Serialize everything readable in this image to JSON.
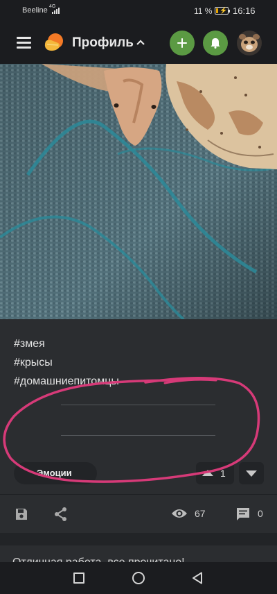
{
  "status_bar": {
    "carrier": "Beeline",
    "network": "4G",
    "battery_percent": "11 %",
    "time": "16:16"
  },
  "top_bar": {
    "title": "Профиль",
    "icons": [
      "menu-icon",
      "logo-icon",
      "chevron-up-icon",
      "plus-icon",
      "bell-icon",
      "avatar"
    ],
    "accent_color": "#5b9a43"
  },
  "post": {
    "tags": [
      "#змея",
      "#крысы",
      "#домашниепитомцы"
    ],
    "emotions_label": "Эмоции",
    "votes": "1"
  },
  "actions": {
    "views": "67",
    "comments": "0",
    "icons": [
      "save-icon",
      "share-icon",
      "eye-icon",
      "comment-icon"
    ]
  },
  "comment_preview": {
    "text": "Отличная работа, все прочитано!"
  },
  "nav_bar": {
    "icons": [
      "recents-icon",
      "home-icon",
      "back-icon"
    ]
  },
  "annotation_color": "#d63a78"
}
